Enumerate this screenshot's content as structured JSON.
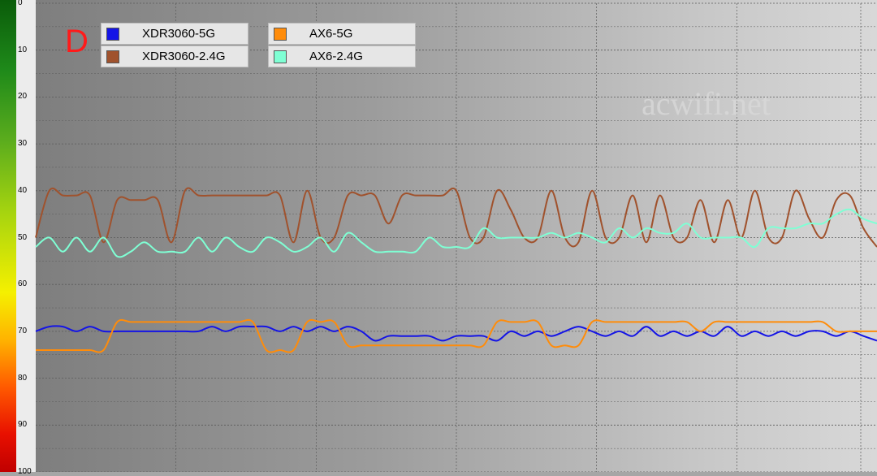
{
  "panel_letter": "D",
  "watermark": "acwifi.net",
  "colors": {
    "xdr5g": "#1414e6",
    "xdr24g": "#a0522d",
    "ax65g": "#ff8c0a",
    "ax624g": "#7fffd4",
    "grid": "#5a5a5a"
  },
  "legend": [
    {
      "label": "XDR3060-5G",
      "color": "#1414e6"
    },
    {
      "label": "AX6-5G",
      "color": "#ff8c0a"
    },
    {
      "label": "XDR3060-2.4G",
      "color": "#a0522d"
    },
    {
      "label": "AX6-2.4G",
      "color": "#7fffd4"
    }
  ],
  "chart_data": {
    "type": "line",
    "title": "",
    "xlabel": "",
    "ylabel": "",
    "ylim": [
      0,
      100
    ],
    "y_inverted": true,
    "yticks": [
      "0",
      "10",
      "20",
      "30",
      "40",
      "50",
      "60",
      "70",
      "80",
      "90",
      "100"
    ],
    "grid": true,
    "legend_position": "top-left",
    "x": [
      0,
      4,
      8,
      12,
      16,
      20,
      24,
      28,
      32,
      36,
      40,
      44,
      48,
      52,
      56,
      60,
      64,
      68,
      72,
      76,
      80,
      84,
      88,
      92,
      96,
      100,
      104,
      108,
      112,
      116,
      120,
      124,
      128,
      132,
      136,
      140,
      144,
      148,
      152,
      156,
      160,
      164,
      168,
      172,
      176,
      180,
      184,
      188,
      192,
      196,
      200,
      204,
      208,
      212,
      216,
      220,
      224,
      228,
      232,
      236,
      240,
      244,
      248
    ],
    "series": [
      {
        "name": "XDR3060-5G",
        "color": "#1414e6",
        "values": [
          70,
          69,
          69,
          70,
          69,
          70,
          70,
          70,
          70,
          70,
          70,
          70,
          70,
          69,
          70,
          69,
          69,
          69,
          70,
          69,
          70,
          69,
          70,
          69,
          70,
          72,
          71,
          71,
          71,
          71,
          72,
          71,
          71,
          71,
          72,
          70,
          71,
          70,
          71,
          70,
          69,
          70,
          71,
          70,
          71,
          69,
          71,
          70,
          71,
          70,
          71,
          69,
          71,
          70,
          71,
          70,
          71,
          70,
          70,
          71,
          70,
          71,
          72
        ]
      },
      {
        "name": "XDR3060-2.4G",
        "color": "#a0522d",
        "values": [
          50,
          40,
          41,
          41,
          41,
          51,
          42,
          42,
          42,
          42,
          51,
          40,
          41,
          41,
          41,
          41,
          41,
          41,
          41,
          51,
          40,
          50,
          50,
          41,
          41,
          41,
          47,
          41,
          41,
          41,
          41,
          40,
          50,
          50,
          40,
          44,
          50,
          50,
          40,
          50,
          51,
          40,
          50,
          50,
          41,
          51,
          41,
          50,
          50,
          42,
          51,
          42,
          50,
          40,
          50,
          50,
          40,
          46,
          50,
          42,
          41,
          48,
          52
        ]
      },
      {
        "name": "AX6-5G",
        "color": "#ff8c0a",
        "values": [
          74,
          74,
          74,
          74,
          74,
          74,
          68,
          68,
          68,
          68,
          68,
          68,
          68,
          68,
          68,
          68,
          68,
          74,
          74,
          74,
          68,
          68,
          68,
          73,
          73,
          73,
          73,
          73,
          73,
          73,
          73,
          73,
          73,
          73,
          68,
          68,
          68,
          68,
          73,
          73,
          73,
          68,
          68,
          68,
          68,
          68,
          68,
          68,
          68,
          70,
          68,
          68,
          68,
          68,
          68,
          68,
          68,
          68,
          68,
          70,
          70,
          70,
          70
        ]
      },
      {
        "name": "AX6-2.4G",
        "color": "#7fffd4",
        "values": [
          52,
          50,
          53,
          50,
          53,
          50,
          54,
          53,
          51,
          53,
          53,
          53,
          50,
          53,
          50,
          52,
          53,
          50,
          51,
          53,
          52,
          50,
          53,
          49,
          51,
          53,
          53,
          53,
          53,
          50,
          52,
          52,
          52,
          48,
          50,
          50,
          50,
          50,
          49,
          50,
          49,
          50,
          51,
          48,
          50,
          48,
          49,
          49,
          47,
          50,
          50,
          50,
          50,
          52,
          48,
          48,
          48,
          47,
          47,
          45,
          44,
          46,
          47
        ]
      }
    ]
  }
}
